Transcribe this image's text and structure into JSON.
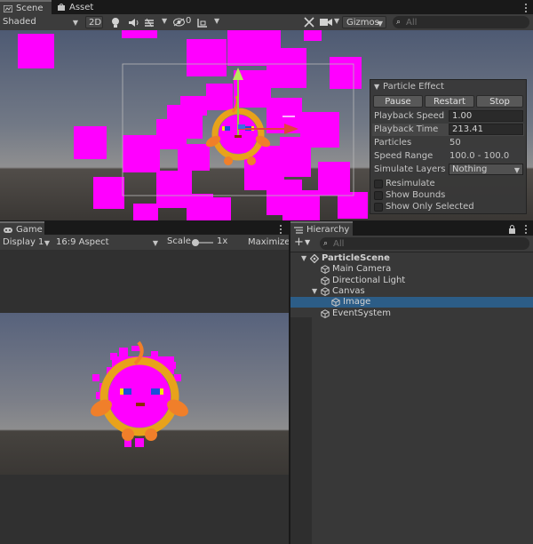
{
  "top_tabs": [
    {
      "label": "Scene",
      "icon": "scene-icon",
      "active": true
    },
    {
      "label": "Asset Store",
      "icon": "asset-store-icon",
      "active": false
    }
  ],
  "scene_toolbar": {
    "shading_mode": "Shaded",
    "mode_2d": "2D",
    "hidden_count": "0",
    "gizmos": "Gizmos",
    "search_placeholder": "All"
  },
  "particle_panel": {
    "title": "Particle Effect",
    "buttons": [
      "Pause",
      "Restart",
      "Stop"
    ],
    "rows": [
      {
        "label": "Playback Speed",
        "value": "1.00"
      },
      {
        "label": "Playback Time",
        "value": "213.41"
      },
      {
        "label": "Particles",
        "value": "50"
      },
      {
        "label": "Speed Range",
        "value": "100.0 - 100.0"
      },
      {
        "label": "Simulate Layers",
        "value": "Nothing"
      }
    ],
    "checkboxes": [
      "Resimulate",
      "Show Bounds",
      "Show Only Selected"
    ]
  },
  "game_tab": {
    "label": "Game",
    "icon": "game-controller-icon"
  },
  "game_toolbar": {
    "display": "Display 1",
    "aspect": "16:9 Aspect",
    "scale_label": "Scale",
    "scale_value": "1x",
    "maximize": "Maximize O"
  },
  "hierarchy": {
    "tab_label": "Hierarchy",
    "search_placeholder": "All",
    "add_label": "+",
    "items": [
      {
        "label": "ParticleScene",
        "indent": 0,
        "icon": "unity-scene-icon",
        "expanded": true,
        "selected": false,
        "bold": true
      },
      {
        "label": "Main Camera",
        "indent": 1,
        "icon": "gameobject-cube-icon",
        "expanded": null,
        "selected": false,
        "bold": false
      },
      {
        "label": "Directional Light",
        "indent": 1,
        "icon": "gameobject-cube-icon",
        "expanded": null,
        "selected": false,
        "bold": false
      },
      {
        "label": "Canvas",
        "indent": 1,
        "icon": "gameobject-cube-icon",
        "expanded": true,
        "selected": false,
        "bold": false
      },
      {
        "label": "Image",
        "indent": 2,
        "icon": "gameobject-cube-icon",
        "expanded": null,
        "selected": true,
        "bold": false
      },
      {
        "label": "EventSystem",
        "indent": 1,
        "icon": "gameobject-cube-icon",
        "expanded": null,
        "selected": false,
        "bold": false
      }
    ]
  },
  "colors": {
    "particle": "#ff00ff",
    "ring": "#e8a21b",
    "selection": "#2c5d87",
    "sky_top": "#57627c",
    "horizon": "#898a8c",
    "ground": "#3d3a37"
  }
}
